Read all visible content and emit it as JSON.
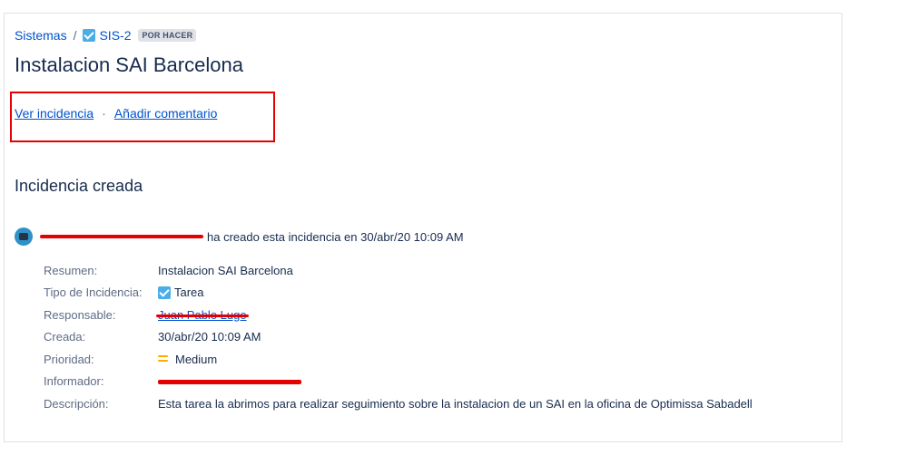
{
  "breadcrumb": {
    "project": "Sistemas",
    "separator": "/",
    "issue_key": "SIS-2",
    "status": "POR HACER"
  },
  "issue": {
    "title": "Instalacion SAI Barcelona"
  },
  "actions": {
    "view": "Ver incidencia",
    "separator": "·",
    "comment": "Añadir comentario"
  },
  "section": {
    "title": "Incidencia creada"
  },
  "activity": {
    "text": "ha creado esta incidencia en 30/abr/20 10:09 AM"
  },
  "details": {
    "summary": {
      "label": "Resumen:",
      "value": "Instalacion SAI Barcelona"
    },
    "type": {
      "label": "Tipo de Incidencia:",
      "value": "Tarea"
    },
    "assignee": {
      "label": "Responsable:",
      "value": "Juan Pablo Lugo"
    },
    "created": {
      "label": "Creada:",
      "value": "30/abr/20 10:09 AM"
    },
    "priority": {
      "label": "Prioridad:",
      "value": "Medium"
    },
    "reporter": {
      "label": "Informador:"
    },
    "description": {
      "label": "Descripción:",
      "value": "Esta tarea la abrimos para realizar seguimiento sobre la instalacion de un SAI en la oficina de Optimissa Sabadell"
    }
  },
  "colors": {
    "link": "#0052cc",
    "text": "#172b4d",
    "muted": "#5e6c84",
    "task_icon": "#4bade8",
    "priority_medium": "#ffab00",
    "highlight_box": "#e60000"
  },
  "icons": {
    "issue_type": "checkbox-task-icon",
    "priority": "priority-medium-icon",
    "avatar": "user-avatar"
  }
}
